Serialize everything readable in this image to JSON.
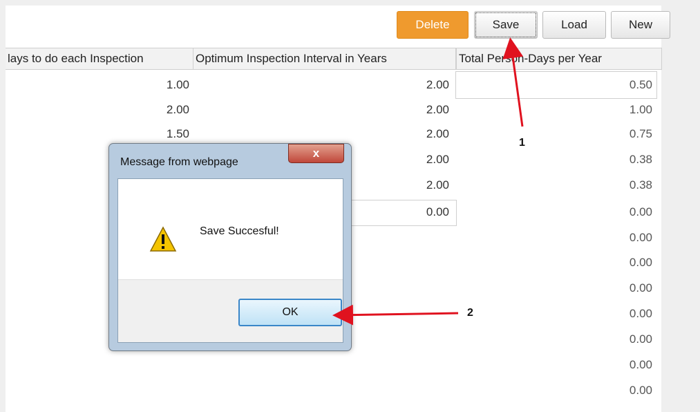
{
  "toolbar": {
    "delete_label": "Delete",
    "save_label": "Save",
    "load_label": "Load",
    "new_label": "New"
  },
  "table": {
    "headers": [
      "lays to do each Inspection",
      "Optimum Inspection Interval in Years",
      "Total Person-Days per Year"
    ],
    "col1": [
      "1.00",
      "2.00",
      "1.50"
    ],
    "col2": [
      "2.00",
      "2.00",
      "2.00",
      "2.00",
      "2.00",
      "0.00"
    ],
    "col3": [
      "0.50",
      "1.00",
      "0.75",
      "0.38",
      "0.38",
      "0.00",
      "0.00",
      "0.00",
      "0.00",
      "0.00",
      "0.00",
      "0.00",
      "0.00"
    ]
  },
  "dialog": {
    "title": "Message from webpage",
    "close_glyph": "x",
    "message": "Save Succesful!",
    "ok_label": "OK",
    "icon": "warning-icon"
  },
  "annotations": {
    "marker1": "1",
    "marker2": "2",
    "arrow_color": "#e0121f"
  },
  "colors": {
    "delete_button": "#ef9a2e",
    "dialog_frame": "#b7cbdf",
    "ok_border": "#3a86c8"
  }
}
